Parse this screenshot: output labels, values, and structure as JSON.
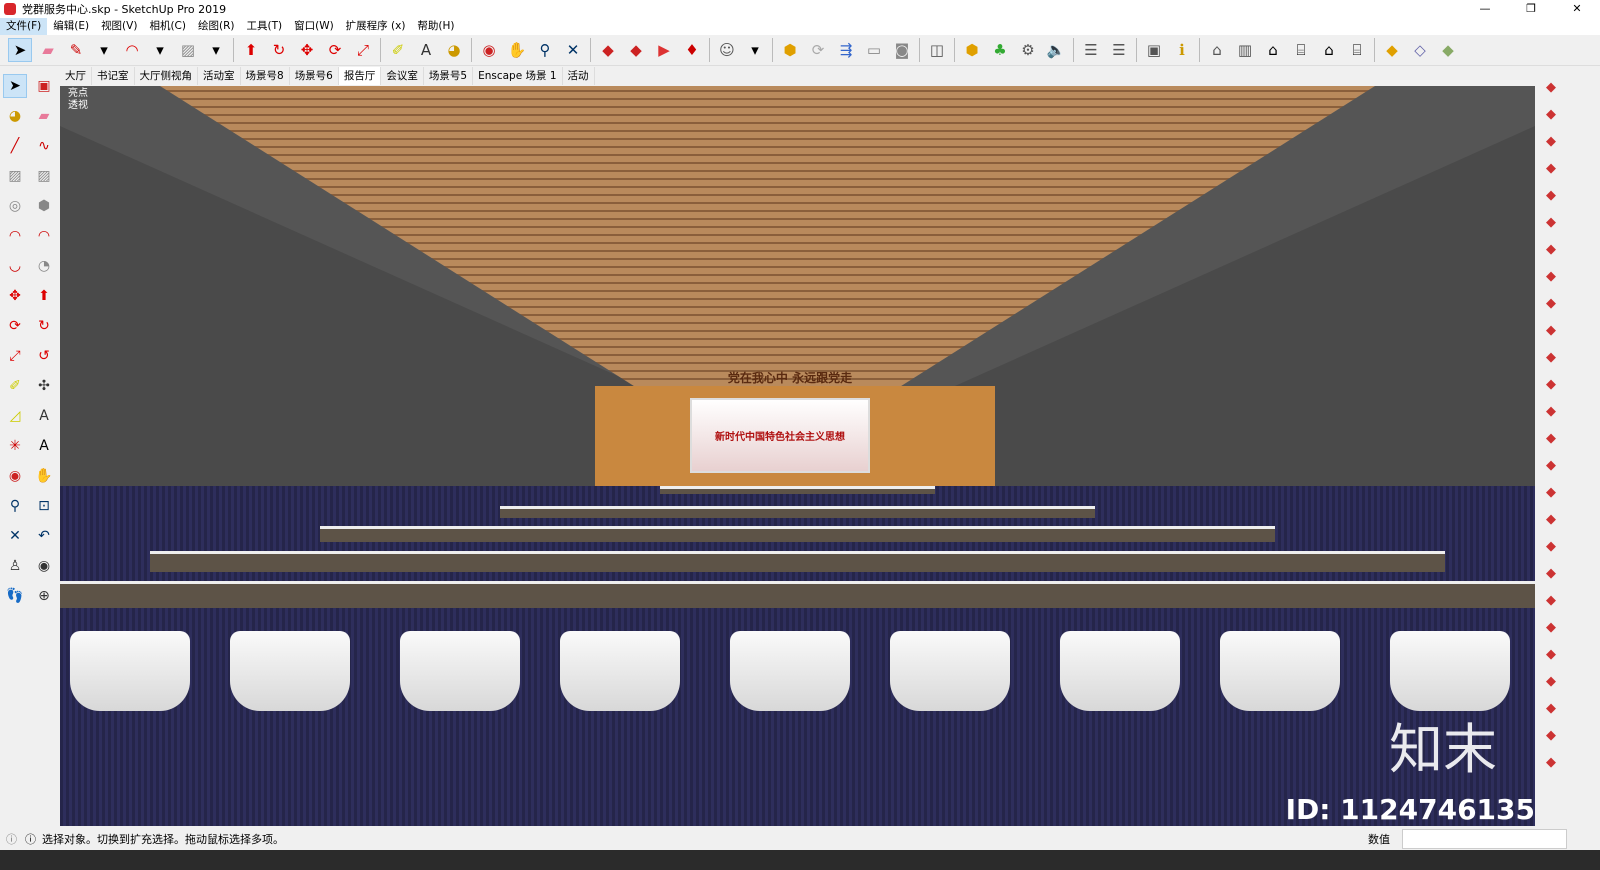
{
  "window": {
    "title": "党群服务中心.skp - SketchUp Pro 2019",
    "controls": [
      "—",
      "❐",
      "✕"
    ]
  },
  "menu": [
    "文件(F)",
    "编辑(E)",
    "视图(V)",
    "相机(C)",
    "绘图(R)",
    "工具(T)",
    "窗口(W)",
    "扩展程序 (x)",
    "帮助(H)"
  ],
  "toolbar": [
    {
      "icon": "select-icon",
      "g": "➤",
      "c": "#000"
    },
    {
      "icon": "eraser-icon",
      "g": "▰",
      "c": "#e87a9a"
    },
    {
      "icon": "pencil-icon",
      "g": "✎",
      "c": "#c00"
    },
    {
      "icon": "dropdown-icon",
      "g": "▾",
      "c": "#000"
    },
    {
      "icon": "arc-icon",
      "g": "◠",
      "c": "#d00"
    },
    {
      "icon": "dropdown-icon",
      "g": "▾",
      "c": "#000"
    },
    {
      "icon": "rectangle-icon",
      "g": "▨",
      "c": "#888"
    },
    {
      "icon": "dropdown-icon",
      "g": "▾",
      "c": "#000"
    },
    {
      "sep": true
    },
    {
      "icon": "push-pull-icon",
      "g": "⬆",
      "c": "#d00"
    },
    {
      "icon": "follow-me-icon",
      "g": "↻",
      "c": "#d00"
    },
    {
      "icon": "move-icon",
      "g": "✥",
      "c": "#d00"
    },
    {
      "icon": "rotate-icon",
      "g": "⟳",
      "c": "#d00"
    },
    {
      "icon": "scale-icon",
      "g": "⤢",
      "c": "#d00"
    },
    {
      "sep": true
    },
    {
      "icon": "tape-measure-icon",
      "g": "✐",
      "c": "#cc0"
    },
    {
      "icon": "text-icon",
      "g": "A",
      "c": "#333"
    },
    {
      "icon": "paint-bucket-icon",
      "g": "◕",
      "c": "#c90"
    },
    {
      "sep": true
    },
    {
      "icon": "orbit-icon",
      "g": "◉",
      "c": "#c22"
    },
    {
      "icon": "pan-icon",
      "g": "✋",
      "c": "#dcb"
    },
    {
      "icon": "zoom-icon",
      "g": "⚲",
      "c": "#036"
    },
    {
      "icon": "zoom-extents-icon",
      "g": "✕",
      "c": "#036"
    },
    {
      "sep": true
    },
    {
      "icon": "warehouse-icon",
      "g": "◆",
      "c": "#c22"
    },
    {
      "icon": "extension-warehouse-icon",
      "g": "◆",
      "c": "#c22"
    },
    {
      "icon": "send-layout-icon",
      "g": "▶",
      "c": "#d33"
    },
    {
      "icon": "ruby-icon",
      "g": "♦",
      "c": "#c00"
    },
    {
      "sep": true
    },
    {
      "icon": "account-icon",
      "g": "☺",
      "c": "#555"
    },
    {
      "icon": "dropdown-icon",
      "g": "▾",
      "c": "#000"
    },
    {
      "sep": true
    },
    {
      "icon": "enscape-start-icon",
      "g": "⬢",
      "c": "#e0a000"
    },
    {
      "icon": "enscape-sync-icon",
      "g": "⟳",
      "c": "#aaa"
    },
    {
      "icon": "enscape-view-icon",
      "g": "⇶",
      "c": "#36c"
    },
    {
      "icon": "enscape-camera-icon",
      "g": "▭",
      "c": "#888"
    },
    {
      "icon": "screenshot-icon",
      "g": "◙",
      "c": "#888"
    },
    {
      "sep": true
    },
    {
      "icon": "vr-icon",
      "g": "◫",
      "c": "#555"
    },
    {
      "sep": true
    },
    {
      "icon": "asset-library-icon",
      "g": "⬢",
      "c": "#e0a000"
    },
    {
      "icon": "tree-icon",
      "g": "♣",
      "c": "#3a3"
    },
    {
      "icon": "settings-icon",
      "g": "⚙",
      "c": "#555"
    },
    {
      "icon": "sound-icon",
      "g": "🔈",
      "c": "#555"
    },
    {
      "sep": true
    },
    {
      "icon": "sliders-icon",
      "g": "☰",
      "c": "#555"
    },
    {
      "icon": "sliders-icon",
      "g": "☰",
      "c": "#555"
    },
    {
      "sep": true
    },
    {
      "icon": "feedback-icon",
      "g": "▣",
      "c": "#555"
    },
    {
      "icon": "info-icon",
      "g": "ℹ",
      "c": "#c90"
    },
    {
      "sep": true
    },
    {
      "icon": "iso-view-icon",
      "g": "⌂",
      "c": "#555"
    },
    {
      "icon": "top-view-icon",
      "g": "▥",
      "c": "#555"
    },
    {
      "icon": "front-view-icon",
      "g": "⌂",
      "c": "#000"
    },
    {
      "icon": "right-view-icon",
      "g": "⌸",
      "c": "#000"
    },
    {
      "icon": "back-view-icon",
      "g": "⌂",
      "c": "#000"
    },
    {
      "icon": "left-view-icon",
      "g": "⌸",
      "c": "#000"
    },
    {
      "sep": true
    },
    {
      "icon": "xray-icon",
      "g": "◆",
      "c": "#e0a000"
    },
    {
      "icon": "wireframe-icon",
      "g": "◇",
      "c": "#66a"
    },
    {
      "icon": "shaded-icon",
      "g": "◆",
      "c": "#8a6"
    }
  ],
  "left_tools": [
    {
      "icon": "select-icon",
      "g": "➤",
      "c": "#000"
    },
    {
      "icon": "component-icon",
      "g": "▣",
      "c": "#c22"
    },
    {
      "icon": "paint-bucket-icon",
      "g": "◕",
      "c": "#c90"
    },
    {
      "icon": "eraser-icon",
      "g": "▰",
      "c": "#e87a9a"
    },
    {
      "icon": "line-icon",
      "g": "╱",
      "c": "#c00"
    },
    {
      "icon": "freehand-icon",
      "g": "∿",
      "c": "#c00"
    },
    {
      "icon": "rectangle-icon",
      "g": "▨",
      "c": "#888"
    },
    {
      "icon": "rotated-rectangle-icon",
      "g": "▨",
      "c": "#888"
    },
    {
      "icon": "circle-icon",
      "g": "◎",
      "c": "#888"
    },
    {
      "icon": "polygon-icon",
      "g": "⬢",
      "c": "#888"
    },
    {
      "icon": "arc-icon",
      "g": "◠",
      "c": "#c00"
    },
    {
      "icon": "arc-2-icon",
      "g": "◠",
      "c": "#c00"
    },
    {
      "icon": "arc-3-icon",
      "g": "◡",
      "c": "#c00"
    },
    {
      "icon": "pie-icon",
      "g": "◔",
      "c": "#888"
    },
    {
      "icon": "move-icon",
      "g": "✥",
      "c": "#d00"
    },
    {
      "icon": "push-pull-icon",
      "g": "⬆",
      "c": "#d00"
    },
    {
      "icon": "rotate-icon",
      "g": "⟳",
      "c": "#d00"
    },
    {
      "icon": "follow-me-icon",
      "g": "↻",
      "c": "#d00"
    },
    {
      "icon": "scale-icon",
      "g": "⤢",
      "c": "#d00"
    },
    {
      "icon": "offset-icon",
      "g": "↺",
      "c": "#d00"
    },
    {
      "icon": "tape-measure-icon",
      "g": "✐",
      "c": "#cc0"
    },
    {
      "icon": "dimension-icon",
      "g": "✣",
      "c": "#333"
    },
    {
      "icon": "protractor-icon",
      "g": "◿",
      "c": "#cc0"
    },
    {
      "icon": "text-icon",
      "g": "A",
      "c": "#333"
    },
    {
      "icon": "axes-icon",
      "g": "✳",
      "c": "#c00"
    },
    {
      "icon": "3d-text-icon",
      "g": "A",
      "c": "#000"
    },
    {
      "icon": "orbit-icon",
      "g": "◉",
      "c": "#c22"
    },
    {
      "icon": "pan-icon",
      "g": "✋",
      "c": "#dcb"
    },
    {
      "icon": "zoom-icon",
      "g": "⚲",
      "c": "#036"
    },
    {
      "icon": "zoom-window-icon",
      "g": "⊡",
      "c": "#036"
    },
    {
      "icon": "zoom-extents-icon",
      "g": "✕",
      "c": "#036"
    },
    {
      "icon": "previous-view-icon",
      "g": "↶",
      "c": "#036"
    },
    {
      "icon": "position-camera-icon",
      "g": "♙",
      "c": "#333"
    },
    {
      "icon": "look-around-icon",
      "g": "◉",
      "c": "#333"
    },
    {
      "icon": "walk-icon",
      "g": "👣",
      "c": "#333"
    },
    {
      "icon": "section-plane-icon",
      "g": "⊕",
      "c": "#333"
    }
  ],
  "right_tools": [
    "move-icon",
    "scale-icon",
    "box-icon",
    "grid-icon",
    "grid-icon",
    "stair-icon",
    "stair-icon",
    "cut-icon",
    "curve-icon",
    "curve-icon",
    "roof-icon",
    "eraser-icon",
    "paint-icon",
    "pipe-icon",
    "hook-icon",
    "pin-icon",
    "component-icon",
    "tool-icon",
    "arrow-icon",
    "arc-icon",
    "solid-icon",
    "solid-icon",
    "shape-icon",
    "shape-icon",
    "axes-icon",
    "pen-icon"
  ],
  "scene_tabs": [
    "大厅",
    "书记室",
    "大厅侧视角",
    "活动室",
    "场景号8",
    "场景号6",
    "报告厅",
    "会议室",
    "场景号5",
    "Enscape 场景 1",
    "活动"
  ],
  "active_tab": "报告厅",
  "viewport": {
    "label_lines": [
      "亮点",
      "透视"
    ],
    "slogan": "党在我心中 永远跟党走",
    "banner": "新时代中国特色社会主义思想",
    "watermark_logo": "知末",
    "watermark_id": "ID: 1124746135"
  },
  "status": {
    "message": "选择对象。切换到扩充选择。拖动鼠标选择多项。",
    "value_label": "数值",
    "value": ""
  }
}
